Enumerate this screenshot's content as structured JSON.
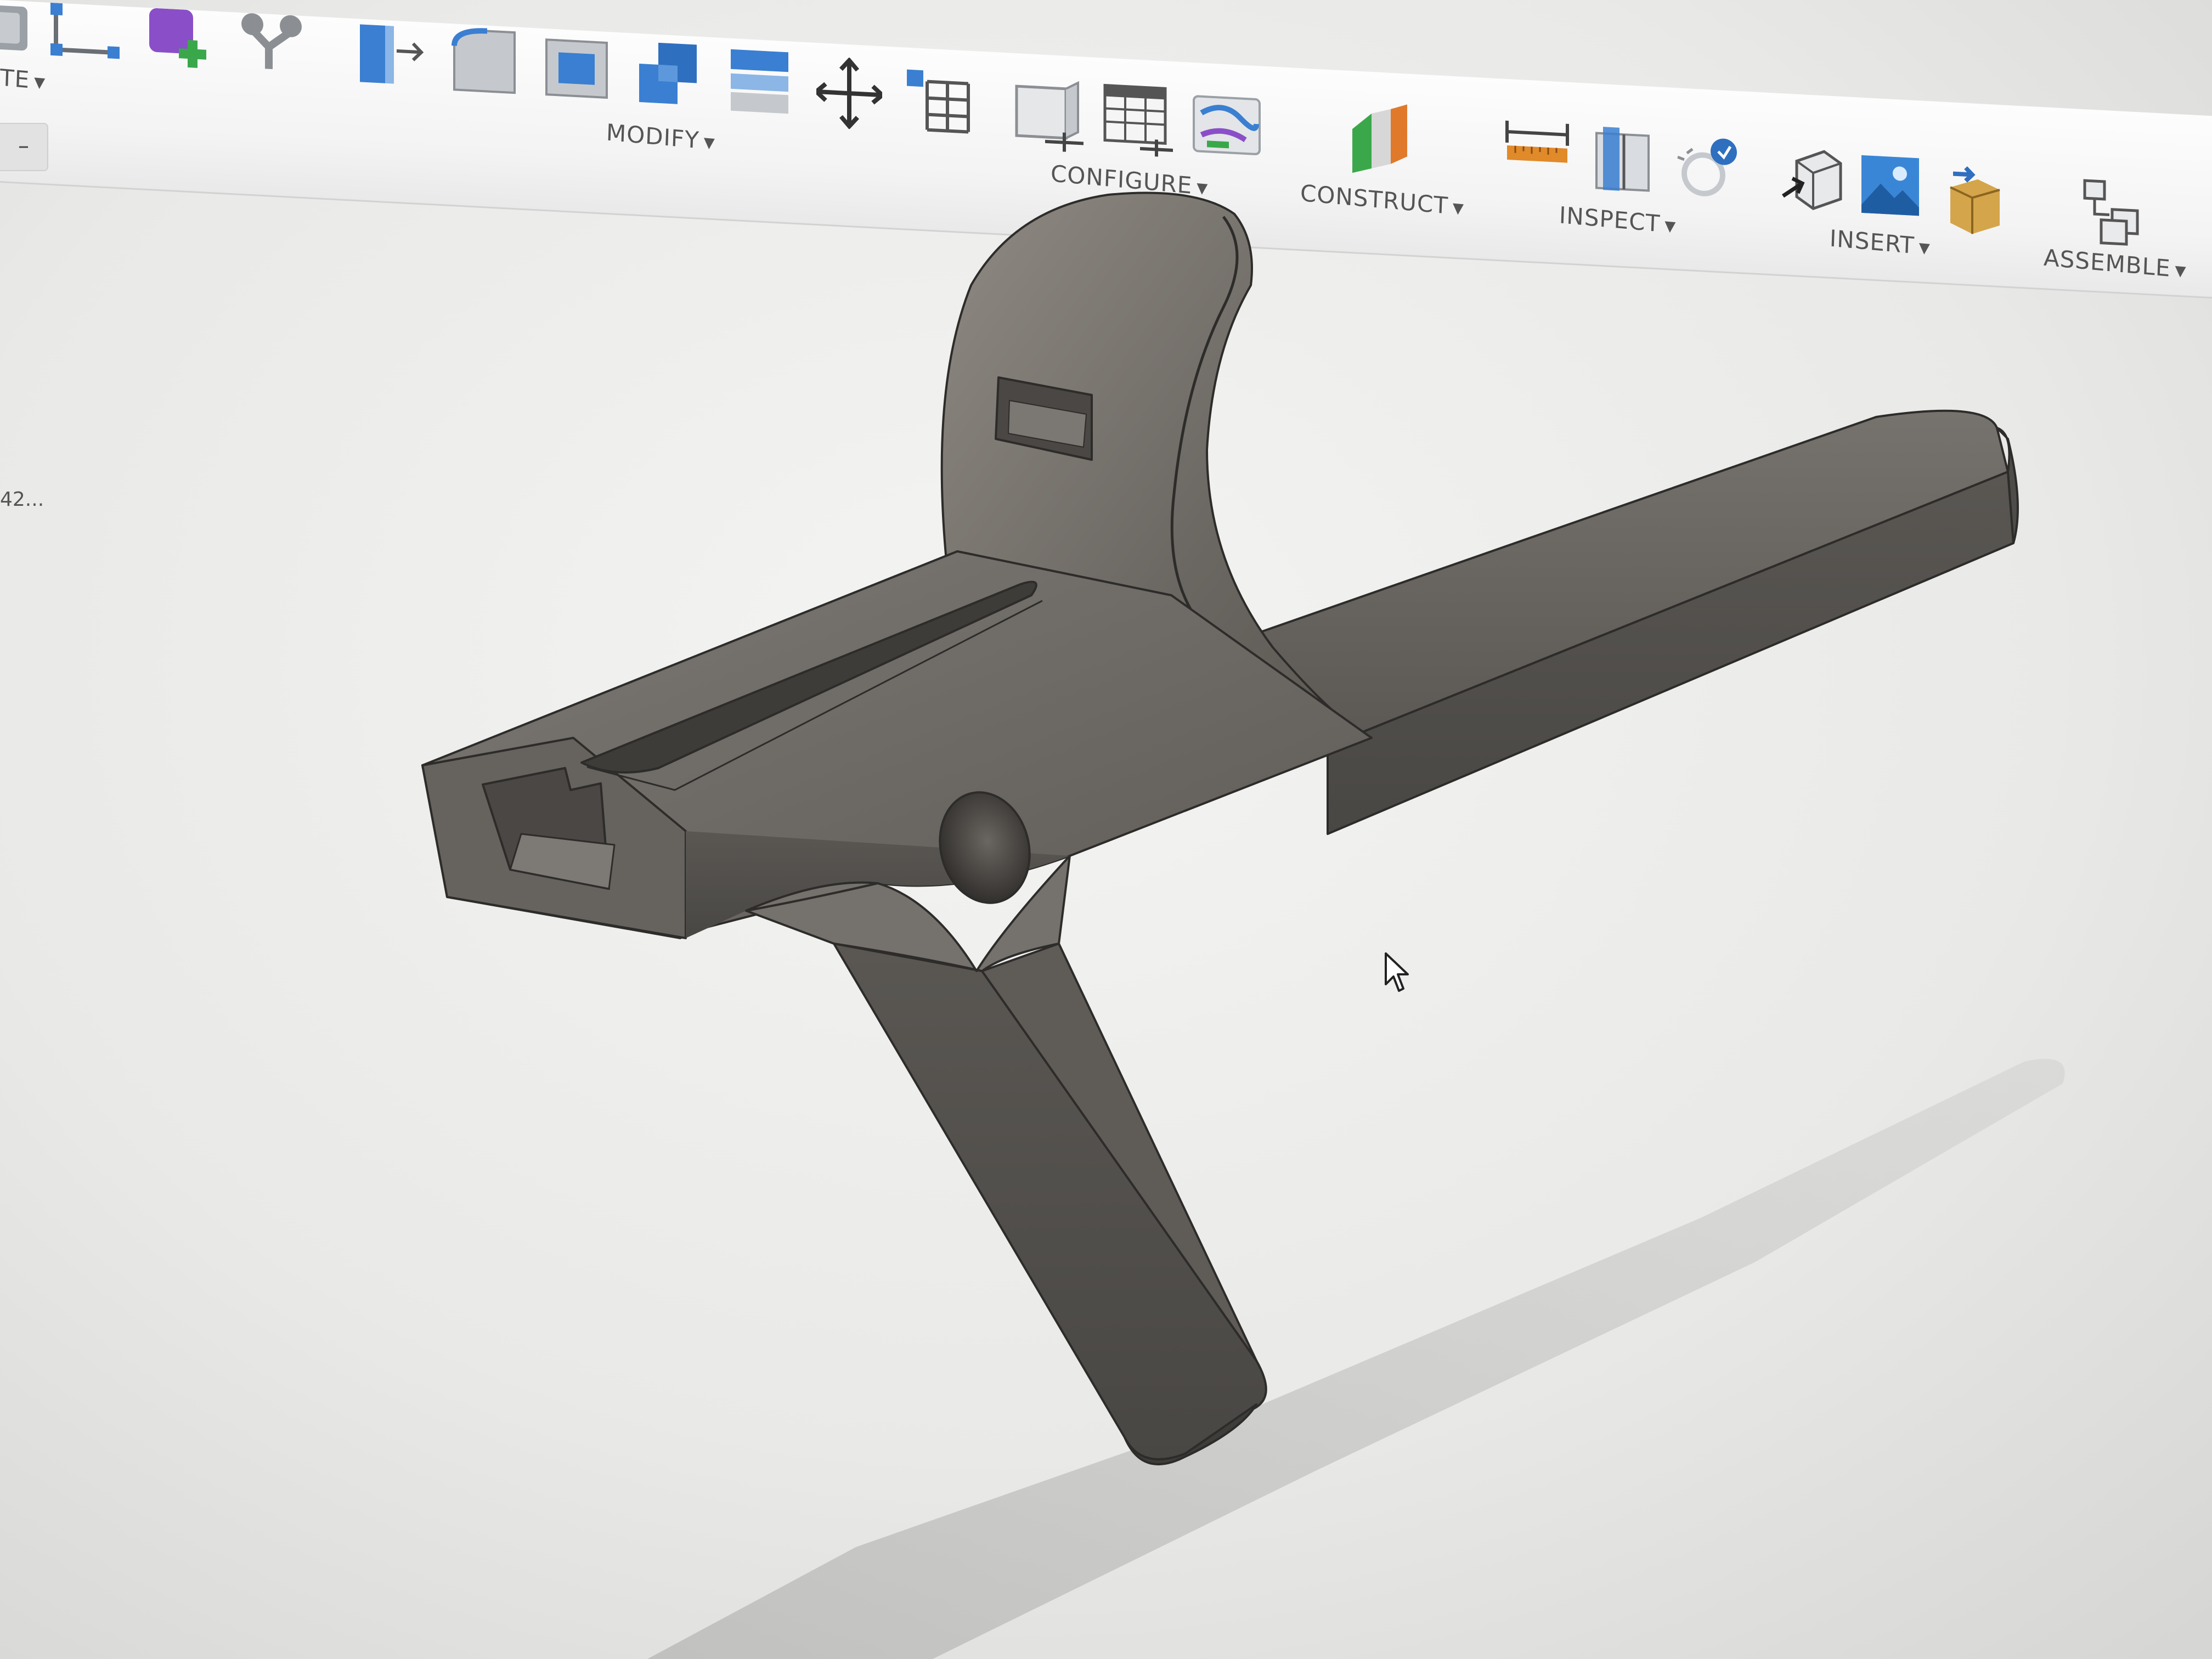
{
  "app": {
    "view": "3D design workspace viewport"
  },
  "toolbar": {
    "groups": [
      {
        "id": "create",
        "label": "TE",
        "icons": [
          "new-component-icon",
          "sketch-icon",
          "create-form-icon",
          "pattern-icon"
        ]
      },
      {
        "id": "modify",
        "label": "MODIFY",
        "icons": [
          "press-pull-icon",
          "fillet-icon",
          "shell-icon",
          "combine-icon",
          "replace-face-icon",
          "move-icon",
          "parameters-icon"
        ]
      },
      {
        "id": "configure",
        "label": "CONFIGURE",
        "icons": [
          "configure-table-icon",
          "configure-rules-icon",
          "configure-theme-icon"
        ]
      },
      {
        "id": "construct",
        "label": "CONSTRUCT",
        "icons": [
          "offset-plane-icon"
        ]
      },
      {
        "id": "inspect",
        "label": "INSPECT",
        "icons": [
          "measure-icon",
          "section-analysis-icon",
          "interference-icon"
        ]
      },
      {
        "id": "insert",
        "label": "INSERT",
        "icons": [
          "insert-derive-icon",
          "insert-canvas-icon",
          "insert-mesh-icon"
        ]
      },
      {
        "id": "assemble",
        "label": "ASSEMBLE",
        "icons": [
          "new-joint-icon"
        ]
      }
    ],
    "colors": {
      "accent_blue": "#3a7fd1",
      "accent_purple": "#8a4fc8",
      "accent_green": "#3aa84a",
      "accent_orange": "#e08a2a",
      "icon_gray": "#8b8f94"
    }
  },
  "browser_panel": {
    "collapse_symbol": "–",
    "item_text": "42..."
  },
  "model": {
    "name": "trigger-shaped bracket part",
    "body_color": "#6e6b66",
    "edge_color": "#2d2c2a"
  },
  "cursor": {
    "icon": "arrow-cursor-icon"
  }
}
